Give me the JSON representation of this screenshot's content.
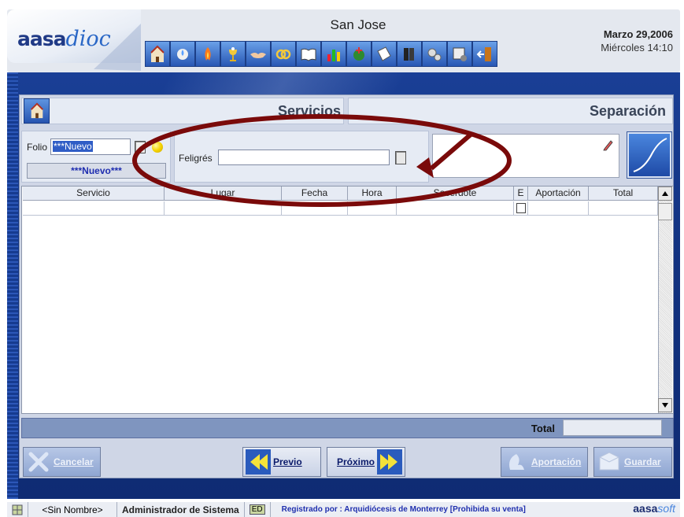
{
  "header": {
    "logo_main": "aasa",
    "logo_tail": "dioc",
    "parish": "San Jose",
    "date": "Marzo 29,2006",
    "day_time": "Miércoles  14:10",
    "toolbar_icons": [
      "church-icon",
      "baptism-icon",
      "confirmation-icon",
      "communion-icon",
      "handshake-icon",
      "rings-icon",
      "book-icon",
      "chart-icon",
      "wreath-icon",
      "certificate-icon",
      "books-icon",
      "gears-icon",
      "settings-icon",
      "exit-icon"
    ]
  },
  "title": {
    "left": "Servicios",
    "right": "Separación"
  },
  "folio": {
    "label": "Folio",
    "value": "***Nuevo",
    "status_text": "***Nuevo***"
  },
  "feligres": {
    "label": "Feligrés",
    "value": ""
  },
  "grid": {
    "columns": [
      "Servicio",
      "Lugar",
      "Fecha",
      "Hora",
      "Sacerdote",
      "E",
      "Aportación",
      "Total"
    ],
    "total_label": "Total",
    "total_value": ""
  },
  "buttons": {
    "cancelar": "Cancelar",
    "previo": "Previo",
    "proximo": "Próximo",
    "aportacion": "Aportación",
    "guardar": "Guardar"
  },
  "statusbar": {
    "name": "<Sin Nombre>",
    "user": "Administrador de Sistema",
    "mode": "ED",
    "registered": "Registrado por : Arquidiócesis de Monterrey  [Prohibida su venta]",
    "brand_main": "aasa",
    "brand_tail": "soft"
  },
  "colors": {
    "frame_blue": "#123382",
    "panel": "#cfd6e6",
    "annotation": "#7a0a0a"
  }
}
